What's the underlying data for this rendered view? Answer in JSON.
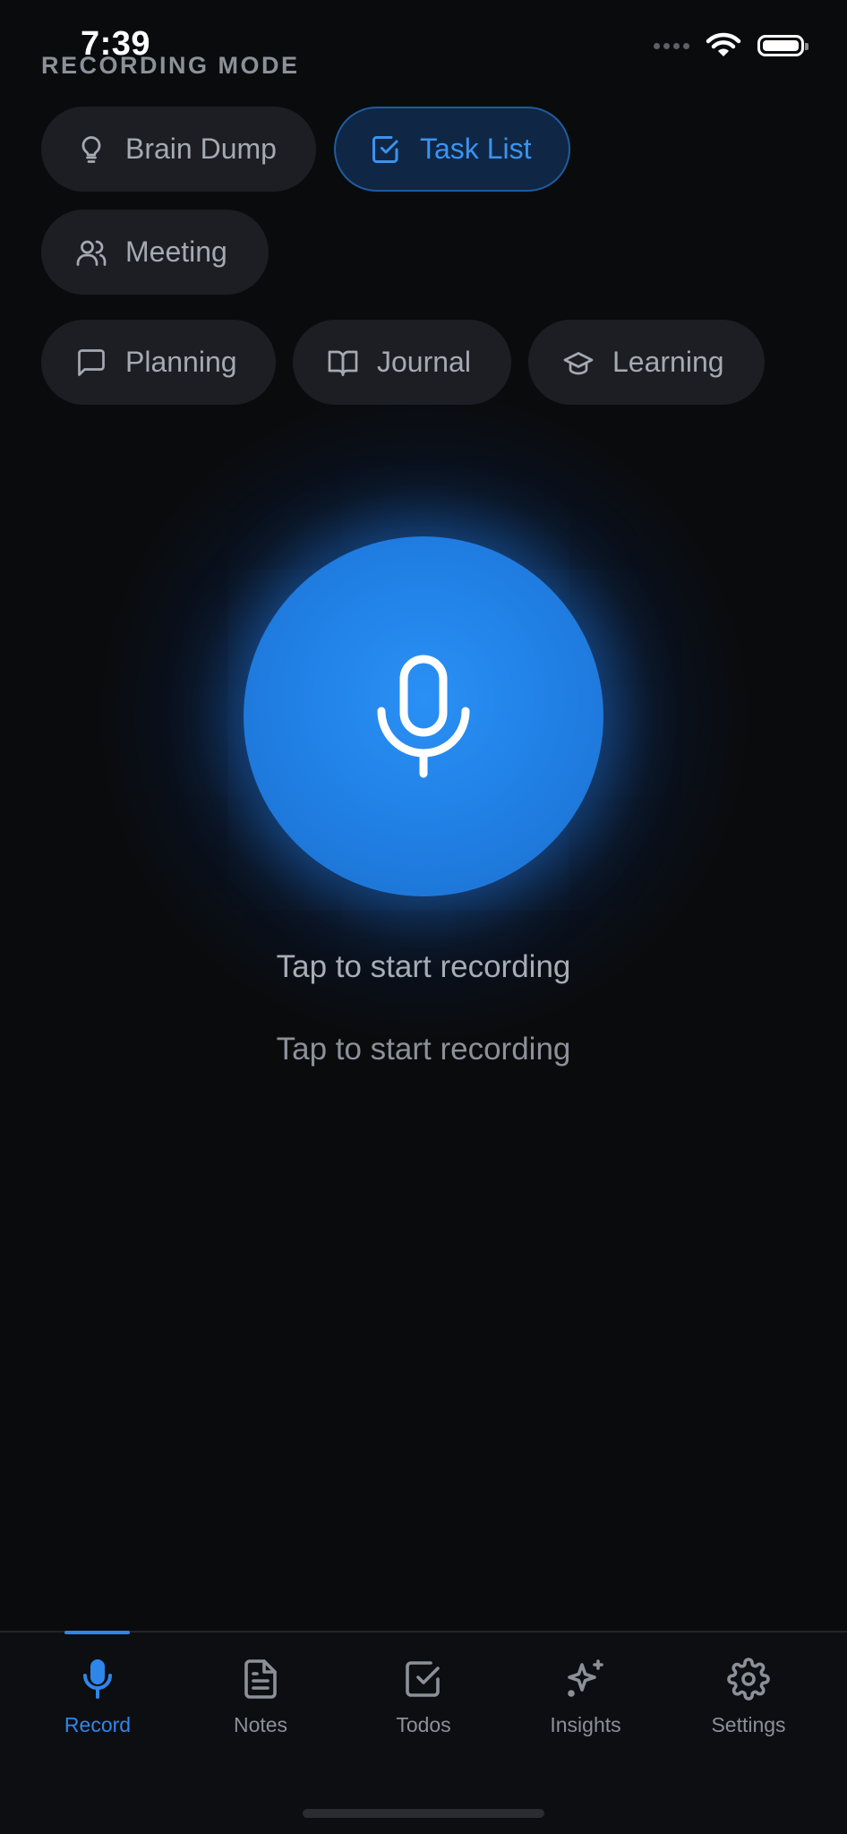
{
  "status_bar": {
    "time": "7:39"
  },
  "mode_heading": "RECORDING MODE",
  "modes": [
    {
      "label": "Brain Dump",
      "icon": "lightbulb-icon"
    },
    {
      "label": "Task List",
      "icon": "check-square-icon",
      "selected": true
    },
    {
      "label": "Meeting",
      "icon": "users-icon"
    },
    {
      "label": "Planning",
      "icon": "message-square-icon"
    },
    {
      "label": "Journal",
      "icon": "book-open-icon"
    },
    {
      "label": "Learning",
      "icon": "graduation-cap-icon"
    }
  ],
  "record_button": {
    "icon": "microphone-icon"
  },
  "prompt": {
    "primary": "Tap to start recording",
    "secondary": "Tap to start recording"
  },
  "tabs": [
    {
      "label": "Record",
      "icon": "microphone-icon",
      "active": true
    },
    {
      "label": "Notes",
      "icon": "file-text-icon"
    },
    {
      "label": "Todos",
      "icon": "check-square-icon"
    },
    {
      "label": "Insights",
      "icon": "sparkles-icon"
    },
    {
      "label": "Settings",
      "icon": "gear-icon"
    }
  ],
  "colors": {
    "background": "#0a0b0d",
    "accent": "#2f86ea",
    "chip_background": "#1c1e23",
    "chip_selected_background": "#0f2744",
    "text_muted": "#8c9099"
  }
}
